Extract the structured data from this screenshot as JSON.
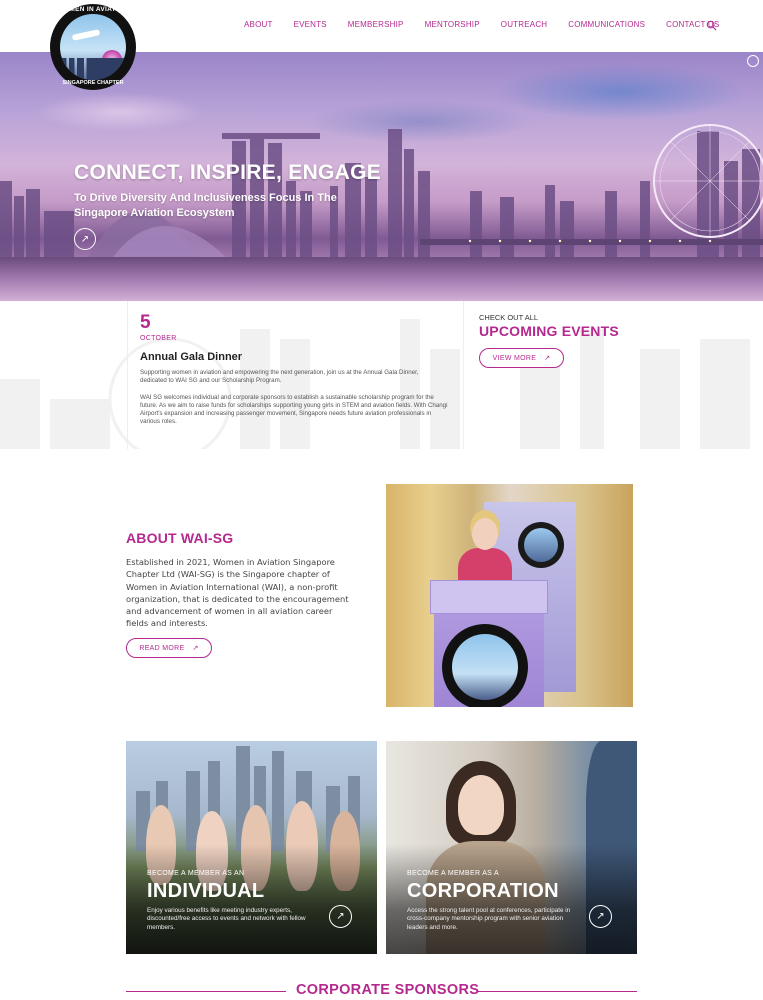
{
  "brand": {
    "logo_top_text": "WOMEN IN AVIATION",
    "logo_bottom_text": "SINGAPORE CHAPTER",
    "accent_color": "#b5298f"
  },
  "nav": {
    "items": [
      {
        "label": "ABOUT"
      },
      {
        "label": "EVENTS"
      },
      {
        "label": "MEMBERSHIP"
      },
      {
        "label": "MENTORSHIP"
      },
      {
        "label": "OUTREACH"
      },
      {
        "label": "COMMUNICATIONS"
      },
      {
        "label": "CONTACT US"
      }
    ],
    "search_icon": "search-icon"
  },
  "hero": {
    "title": "CONNECT, INSPIRE, ENGAGE",
    "subtitle": "To Drive Diversity And Inclusiveness Focus In The Singapore Aviation Ecosystem",
    "cta_icon": "arrow-up-right-icon"
  },
  "event": {
    "day": "5",
    "month": "OCTOBER",
    "title": "Annual Gala Dinner",
    "description_1": "Supporting women in aviation and empowering the next generation, join us at the Annual Gala Dinner, dedicated to WAI SG and our Scholarship Program.",
    "description_2": "WAI SG welcomes individual and corporate sponsors to establish a sustainable scholarship program for the future. As we aim to raise funds for scholarships supporting young girls in STEM and aviation fields. With Changi Airport's expansion and increasing passenger movement, Singapore needs future aviation professionals in various roles."
  },
  "upcoming": {
    "kicker": "CHECK OUT ALL",
    "title": "UPCOMING EVENTS",
    "button": "VIEW MORE"
  },
  "about": {
    "title": "ABOUT WAI-SG",
    "text": "Established in 2021, Women in Aviation Singapore Chapter Ltd (WAI-SG) is the Singapore chapter of Women in Aviation International (WAI), a non-profit organization, that is dedicated to the encouragement and advancement of women in all aviation career fields and interests.",
    "button": "READ MORE"
  },
  "membership": {
    "individual": {
      "kicker": "BECOME A MEMBER AS AN",
      "title": "INDIVIDUAL",
      "description": "Enjoy various benefits like meeting industry experts, discounted/free access to events and network with fellow members."
    },
    "corporation": {
      "kicker": "BECOME A MEMBER AS A",
      "title": "CORPORATION",
      "description": "Access the strong talent pool at conferences, participate in cross-company mentorship program with senior aviation leaders and more."
    }
  },
  "sponsors": {
    "title": "CORPORATE SPONSORS"
  }
}
